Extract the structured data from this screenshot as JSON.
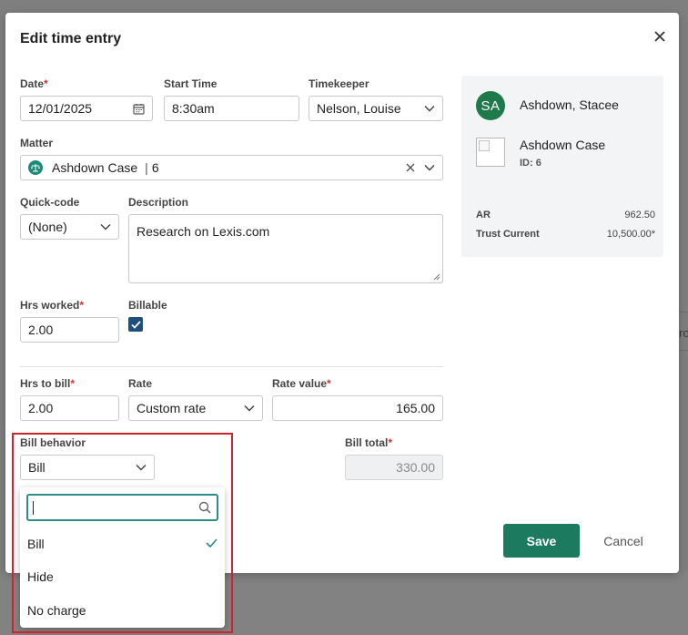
{
  "dialog": {
    "title": "Edit time entry"
  },
  "form": {
    "date": {
      "label": "Date",
      "value": "12/01/2025"
    },
    "start_time": {
      "label": "Start Time",
      "value": "8:30am"
    },
    "timekeeper": {
      "label": "Timekeeper",
      "value": "Nelson, Louise"
    },
    "matter": {
      "label": "Matter",
      "name": "Ashdown Case",
      "id": "6"
    },
    "quick_code": {
      "label": "Quick-code",
      "value": "(None)"
    },
    "description": {
      "label": "Description",
      "value": "Research on Lexis.com"
    },
    "hrs_worked": {
      "label": "Hrs worked",
      "value": "2.00"
    },
    "billable": {
      "label": "Billable",
      "checked": true
    },
    "hrs_to_bill": {
      "label": "Hrs to bill",
      "value": "2.00"
    },
    "rate": {
      "label": "Rate",
      "value": "Custom rate"
    },
    "rate_value": {
      "label": "Rate value",
      "value": "165.00"
    },
    "bill_behavior": {
      "label": "Bill behavior",
      "value": "Bill"
    },
    "bill_total": {
      "label": "Bill total",
      "value": "330.00"
    }
  },
  "required_marker": "*",
  "side_panel": {
    "avatar_initials": "SA",
    "client_name": "Ashdown, Stacee",
    "case_name": "Ashdown Case",
    "case_id": "ID: 6",
    "ar_label": "AR",
    "ar_value": "962.50",
    "trust_label": "Trust Current",
    "trust_value": "10,500.00*"
  },
  "actions": {
    "save": "Save",
    "cancel": "Cancel"
  },
  "dropdown": {
    "search_value": "",
    "options": [
      "Bill",
      "Hide",
      "No charge"
    ],
    "selected": "Bill"
  },
  "colors": {
    "accent": "#1c7b5f",
    "focus": "#2e8c88",
    "required": "#d6343a",
    "highlight": "#d0242c"
  },
  "backdrop": {
    "text_fragment": "ro"
  }
}
